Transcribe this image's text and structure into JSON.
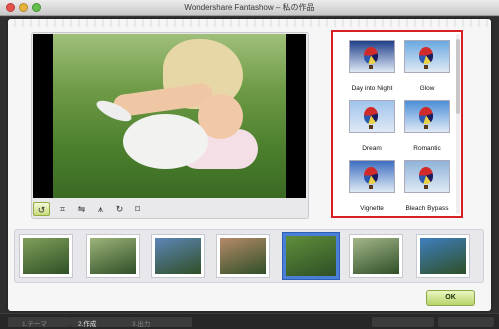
{
  "window": {
    "title": "Wondershare Fantashow – 私の作品"
  },
  "toolbar": {
    "tools": [
      {
        "icon": "rotate-icon",
        "glyph": "↺",
        "active": true
      },
      {
        "icon": "crop-icon",
        "glyph": "⌗",
        "active": false
      },
      {
        "icon": "flip-icon",
        "glyph": "⇋",
        "active": false
      },
      {
        "icon": "mirror-icon",
        "glyph": "⩚",
        "active": false
      },
      {
        "icon": "rotate-right-icon",
        "glyph": "↻",
        "active": false
      },
      {
        "icon": "frame-icon",
        "glyph": "⌑",
        "active": false
      }
    ]
  },
  "effects": {
    "items": [
      {
        "label": "Day into Night",
        "bg": "#1f3f8a"
      },
      {
        "label": "Glow",
        "bg": "#6aa8e0"
      },
      {
        "label": "Dream",
        "bg": "#9fc4ec"
      },
      {
        "label": "Romantic",
        "bg": "#4b8fd8"
      },
      {
        "label": "Vignette",
        "bg": "#3d6fc0"
      },
      {
        "label": "Bleach Bypass",
        "bg": "#8fb3d8"
      }
    ]
  },
  "filmstrip": {
    "items": [
      {
        "color": "#7fa05a",
        "selected": false
      },
      {
        "color": "#9db37a",
        "selected": false
      },
      {
        "color": "#5d86b8",
        "selected": false
      },
      {
        "color": "#b58a6a",
        "selected": false
      },
      {
        "color": "#5f8e3a",
        "selected": true
      },
      {
        "color": "#a4b68a",
        "selected": false
      },
      {
        "color": "#3e7fc0",
        "selected": false
      }
    ]
  },
  "actions": {
    "ok_label": "OK"
  },
  "steps": [
    {
      "label": "1.テーマ",
      "current": false
    },
    {
      "label": "2.作成",
      "current": true
    },
    {
      "label": "3.出力",
      "current": false
    }
  ]
}
